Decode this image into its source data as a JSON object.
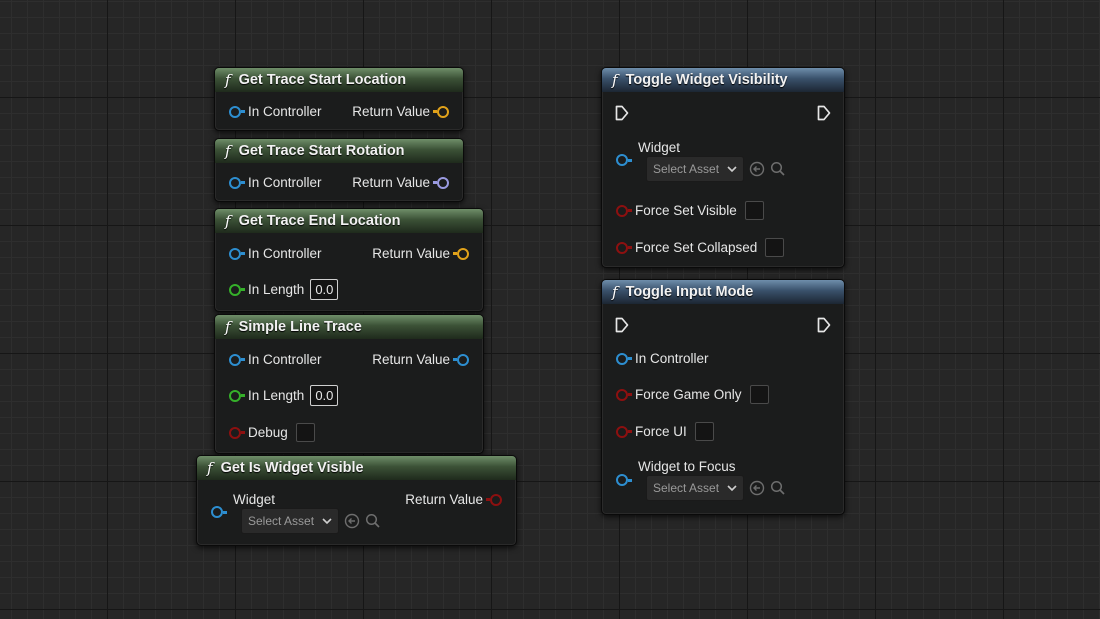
{
  "nodes": {
    "get_trace_start_location": {
      "title": "Get Trace Start Location",
      "in_controller": "In Controller",
      "return_value": "Return Value"
    },
    "get_trace_start_rotation": {
      "title": "Get Trace Start Rotation",
      "in_controller": "In Controller",
      "return_value": "Return Value"
    },
    "get_trace_end_location": {
      "title": "Get Trace End Location",
      "in_controller": "In Controller",
      "return_value": "Return Value",
      "in_length": "In Length",
      "in_length_value": "0.0"
    },
    "simple_line_trace": {
      "title": "Simple Line Trace",
      "in_controller": "In Controller",
      "return_value": "Return Value",
      "in_length": "In Length",
      "in_length_value": "0.0",
      "debug": "Debug"
    },
    "get_is_widget_visible": {
      "title": "Get Is Widget Visible",
      "widget": "Widget",
      "return_value": "Return Value",
      "select_asset": "Select Asset"
    },
    "toggle_widget_visibility": {
      "title": "Toggle Widget Visibility",
      "widget": "Widget",
      "select_asset": "Select Asset",
      "force_set_visible": "Force Set Visible",
      "force_set_collapsed": "Force Set Collapsed"
    },
    "toggle_input_mode": {
      "title": "Toggle Input Mode",
      "in_controller": "In Controller",
      "force_game_only": "Force Game Only",
      "force_ui": "Force UI",
      "widget_to_focus": "Widget to Focus",
      "select_asset": "Select Asset"
    }
  },
  "icons": {
    "function": "function-icon",
    "exec": "exec-pin-icon",
    "browse": "browse-arrow-icon",
    "search": "search-icon",
    "chevron": "chevron-down-icon"
  },
  "colors": {
    "object_pin": "#2d8ed0",
    "vector_pin": "#e1a21a",
    "rotator_pin": "#9a9ae0",
    "float_pin": "#35b02a",
    "bool_pin": "#8d1010",
    "function_header": "#4a6344",
    "impure_header": "#4a6a8a"
  }
}
